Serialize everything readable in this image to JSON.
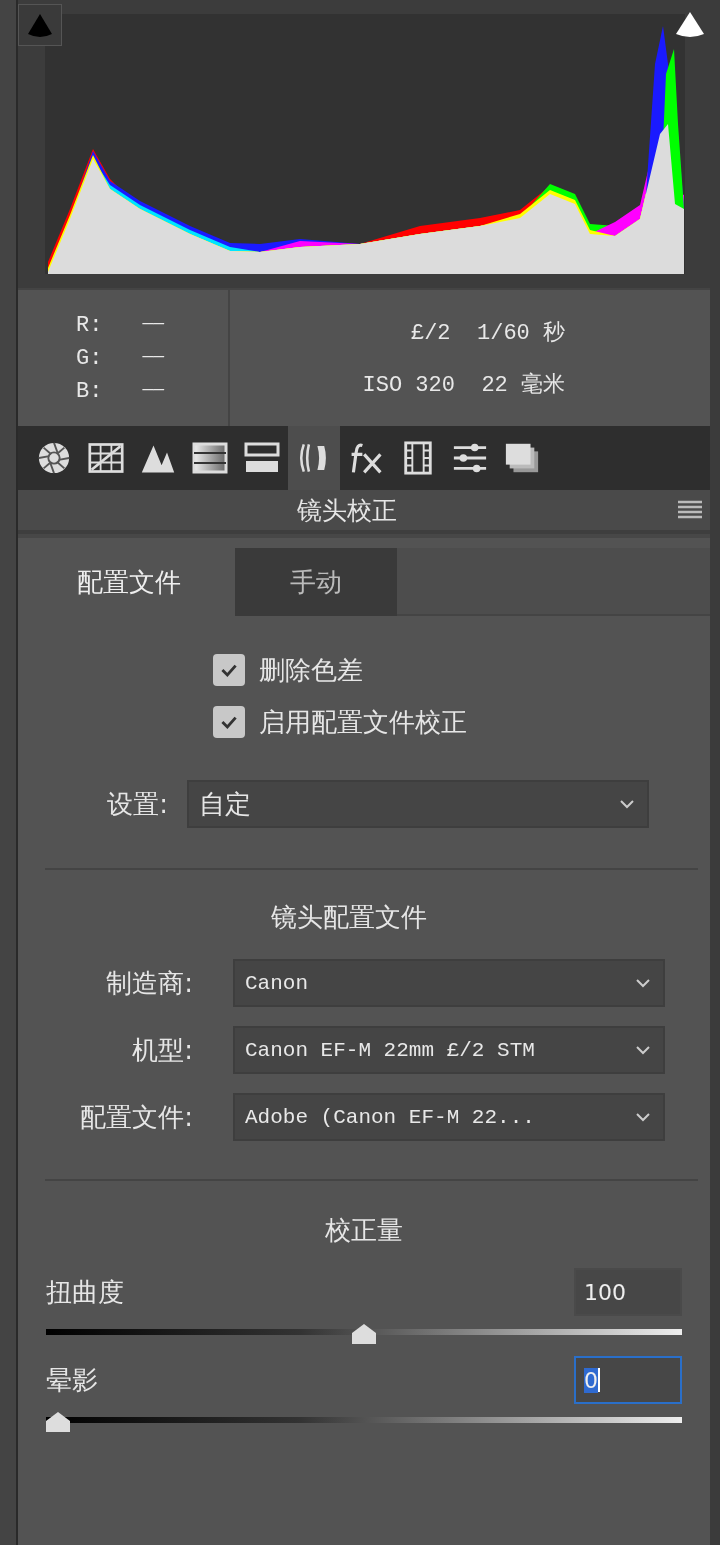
{
  "readout": {
    "rgb": [
      {
        "label": "R:",
        "value": "——"
      },
      {
        "label": "G:",
        "value": "——"
      },
      {
        "label": "B:",
        "value": "——"
      }
    ],
    "exposure": [
      "£/2  1/60 秒",
      "ISO 320  22 毫米"
    ]
  },
  "tools": [
    {
      "kind": "aperture",
      "selected": false
    },
    {
      "kind": "curve",
      "selected": false
    },
    {
      "kind": "mountains",
      "selected": false
    },
    {
      "kind": "gradient",
      "selected": false
    },
    {
      "kind": "split",
      "selected": false
    },
    {
      "kind": "lens",
      "selected": true
    },
    {
      "kind": "fx",
      "selected": false
    },
    {
      "kind": "film",
      "selected": false
    },
    {
      "kind": "sliders",
      "selected": false
    },
    {
      "kind": "stack",
      "selected": false
    }
  ],
  "panel": {
    "title": "镜头校正"
  },
  "tabs": [
    {
      "label": "配置文件",
      "selected": true
    },
    {
      "label": "手动",
      "selected": false
    }
  ],
  "checkboxes": [
    {
      "label": "删除色差",
      "checked": true
    },
    {
      "label": "启用配置文件校正",
      "checked": true
    }
  ],
  "setup": {
    "label": "设置:",
    "value": "自定"
  },
  "lens_profile": {
    "title": "镜头配置文件",
    "fields": [
      {
        "label": "制造商:",
        "value": "Canon"
      },
      {
        "label": "机型:",
        "value": "Canon EF-M 22mm £/2 STM"
      },
      {
        "label": "配置文件:",
        "value": "Adobe (Canon EF-M 22..."
      }
    ]
  },
  "amount": {
    "title": "校正量",
    "sliders": [
      {
        "label": "扭曲度",
        "value": "100",
        "level": 0.5,
        "focused": false
      },
      {
        "label": "晕影",
        "value": "0",
        "level": 0,
        "focused": true
      }
    ]
  }
}
